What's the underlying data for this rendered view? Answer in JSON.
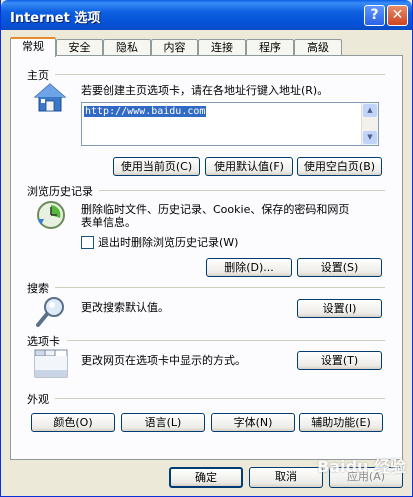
{
  "window": {
    "title": "Internet 选项",
    "help_glyph": "?",
    "close_glyph": "✕"
  },
  "tabs": [
    "常规",
    "安全",
    "隐私",
    "内容",
    "连接",
    "程序",
    "高级"
  ],
  "home": {
    "label": "主页",
    "desc": "若要创建主页选项卡，请在各地址行键入地址(R)。",
    "url": "http://www.baidu.com",
    "btn_current": "使用当前页(C)",
    "btn_default": "使用默认值(F)",
    "btn_blank": "使用空白页(B)"
  },
  "history": {
    "label": "浏览历史记录",
    "desc1": "删除临时文件、历史记录、Cookie、保存的密码和网页",
    "desc2": "表单信息。",
    "checkbox_label": "退出时删除浏览历史记录(W)",
    "btn_delete": "删除(D)...",
    "btn_settings": "设置(S)"
  },
  "search": {
    "label": "搜索",
    "desc": "更改搜索默认值。",
    "btn_settings": "设置(I)"
  },
  "tabs_section": {
    "label": "选项卡",
    "desc": "更改网页在选项卡中显示的方式。",
    "btn_settings": "设置(T)"
  },
  "appearance": {
    "label": "外观",
    "btn_colors": "颜色(O)",
    "btn_languages": "语言(L)",
    "btn_fonts": "字体(N)",
    "btn_accessibility": "辅助功能(E)"
  },
  "footer": {
    "ok": "确定",
    "cancel": "取消",
    "apply": "应用(A)"
  },
  "watermark": "Baidu 经验"
}
